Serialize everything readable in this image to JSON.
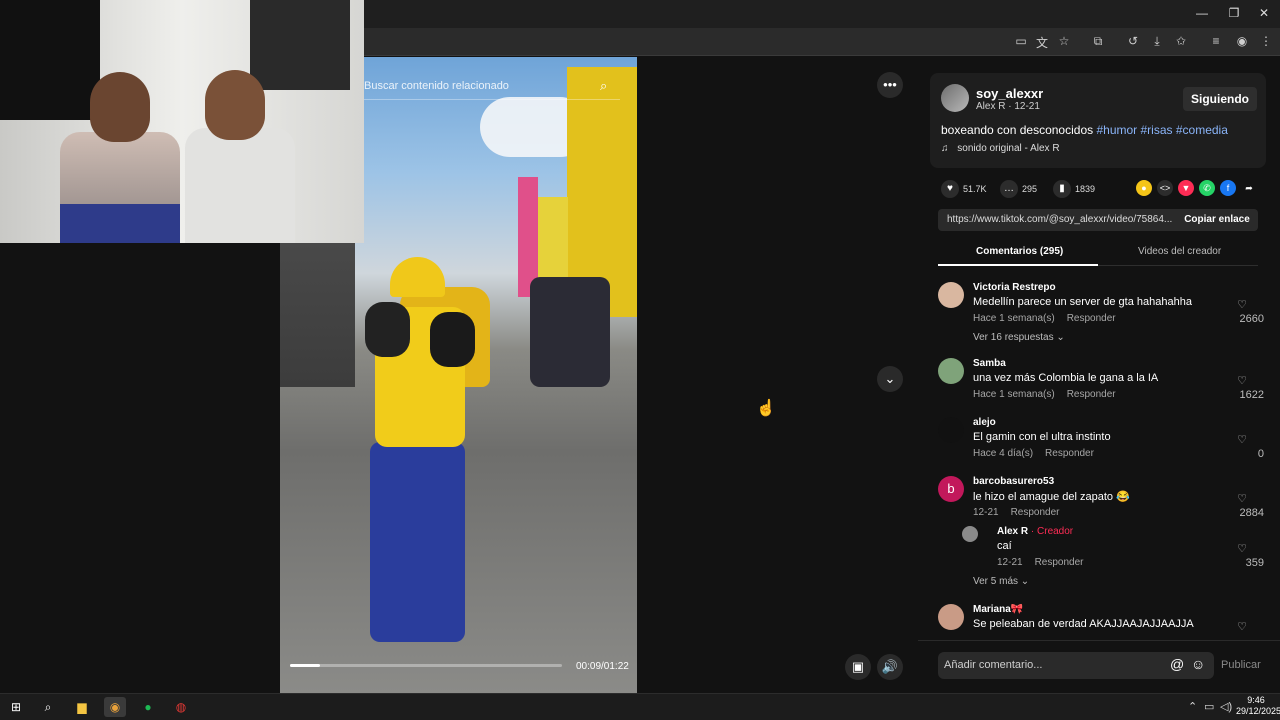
{
  "window": {
    "minimize": "—",
    "restore": "❐",
    "close": "✕"
  },
  "toolbar_icons": [
    "cast-icon",
    "translate-icon",
    "star-icon",
    "extensions-icon",
    "history-icon",
    "download-icon",
    "favorites-icon",
    "reading-list-icon",
    "profile-icon",
    "menu-icon"
  ],
  "video": {
    "search_placeholder": "Buscar contenido relacionado",
    "time": "00:09/01:22",
    "progress": 0.11
  },
  "author": {
    "username": "soy_alexxr",
    "sub": "Alex R · 12-21",
    "follow_label": "Siguiendo",
    "description": "boxeando con desconocidos",
    "hashtags": [
      "#humor",
      "#risas",
      "#comedia"
    ],
    "music": "sonido original - Alex R"
  },
  "stats": {
    "likes": "51.7K",
    "comments": "295",
    "saves": "1839"
  },
  "share_link": {
    "url": "https://www.tiktok.com/@soy_alexxr/video/75864...",
    "copy_label": "Copiar enlace"
  },
  "tabs": {
    "comments": "Comentarios (295)",
    "creator_videos": "Videos del creador"
  },
  "comments": [
    {
      "name": "Victoria Restrepo",
      "text": "Medellín parece un server de gta hahahahha",
      "time": "Hace 1 semana(s)",
      "reply": "Responder",
      "likes": "2660",
      "more": "Ver 16 respuestas ⌄",
      "avatar_color": "#d9b7a0"
    },
    {
      "name": "Samba",
      "text": "una vez más Colombia le gana a la IA",
      "time": "Hace 1 semana(s)",
      "reply": "Responder",
      "likes": "1622",
      "avatar_color": "#7fa37a"
    },
    {
      "name": "alejo",
      "text": "El gamin con el ultra instinto",
      "time": "Hace 4 día(s)",
      "reply": "Responder",
      "likes": "0",
      "avatar_color": "#111111"
    },
    {
      "name": "barcobasurero53",
      "text": "le hizo el amague del zapato 😂",
      "time": "12-21",
      "reply": "Responder",
      "likes": "2884",
      "avatar_letter": "b",
      "avatar_color": "#c2185b"
    },
    {
      "name": "Alex R",
      "creator_tag": " · Creador",
      "text": "caí",
      "time": "12-21",
      "reply": "Responder",
      "likes": "359",
      "more": "Ver 5 más ⌄",
      "avatar_color": "#8a8a8a"
    },
    {
      "name": "Mariana🎀",
      "text": "Se peleaban de verdad AKAJJAAJAJJAAJJA",
      "likes": "",
      "avatar_color": "#c99b86"
    }
  ],
  "comment_box": {
    "placeholder": "Añadir comentario...",
    "at": "@",
    "emoji": "☺",
    "publish": "Publicar"
  },
  "taskbar": {
    "time": "9:46",
    "date": "29/12/2025"
  }
}
